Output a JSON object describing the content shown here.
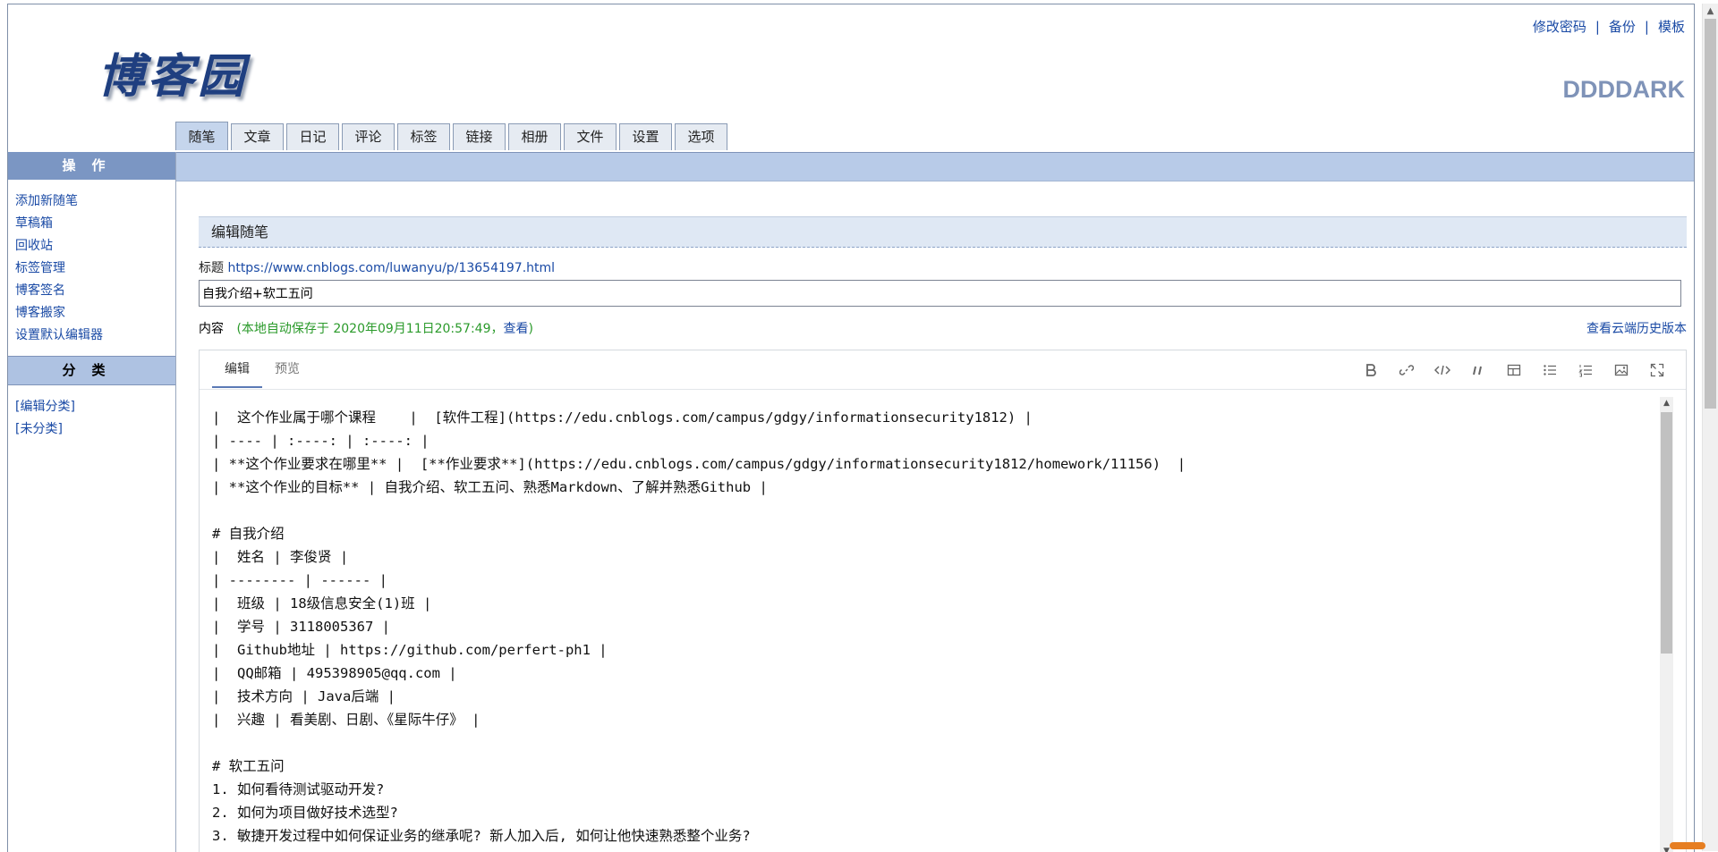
{
  "header": {
    "logo": "博客园",
    "top_links": [
      "修改密码",
      "备份",
      "模板"
    ],
    "separator": "|",
    "blog_name": "DDDDARK"
  },
  "tabs": [
    "随笔",
    "文章",
    "日记",
    "评论",
    "标签",
    "链接",
    "相册",
    "文件",
    "设置",
    "选项"
  ],
  "sidebar": {
    "ops_title": "操作",
    "ops_items": [
      "添加新随笔",
      "草稿箱",
      "回收站",
      "标签管理",
      "博客签名",
      "博客搬家",
      "设置默认编辑器"
    ],
    "cat_title": "分类",
    "cat_items": [
      "[编辑分类]",
      "[未分类]"
    ]
  },
  "editor_section": {
    "heading": "编辑随笔",
    "title_label": "标题",
    "title_link": "https://www.cnblogs.com/luwanyu/p/13654197.html",
    "title_value": "自我介绍+软工五问",
    "content_label": "内容",
    "autosave_prefix": "(本地自动保存于 2020年09月11日20:57:49，",
    "autosave_link": "查看",
    "autosave_suffix": ")",
    "cloud_history": "查看云端历史版本",
    "editor_tabs": [
      "编辑",
      "预览"
    ],
    "toolbar_icons": [
      "bold-icon",
      "link-icon",
      "code-icon",
      "quote-icon",
      "table-icon",
      "bullet-list-icon",
      "numbered-list-icon",
      "image-icon",
      "fullscreen-icon"
    ],
    "content_lines": [
      "|  这个作业属于哪个课程    |  [软件工程](https://edu.cnblogs.com/campus/gdgy/informationsecurity1812) |",
      "| ---- | :----: | :----: |",
      "| **这个作业要求在哪里** |  [**作业要求**](https://edu.cnblogs.com/campus/gdgy/informationsecurity1812/homework/11156)  |",
      "| **这个作业的目标** | 自我介绍、软工五问、熟悉Markdown、了解并熟悉Github |",
      "",
      "# 自我介绍",
      "|  姓名 | 李俊贤 |",
      "| -------- | ------ |",
      "|  班级 | 18级信息安全(1)班 |",
      "|  学号 | 3118005367 |",
      "|  Github地址 | https://github.com/perfert-ph1 |",
      "|  QQ邮箱 | 495398905@qq.com |",
      "|  技术方向 | Java后端 |",
      "|  兴趣 | 看美剧、日剧、《星际牛仔》 |",
      "",
      "# 软工五问",
      "1. 如何看待测试驱动开发?",
      "2. 如何为项目做好技术选型?",
      "3. 敏捷开发过程中如何保证业务的继承呢? 新人加入后, 如何让他快速熟悉整个业务?"
    ]
  }
}
